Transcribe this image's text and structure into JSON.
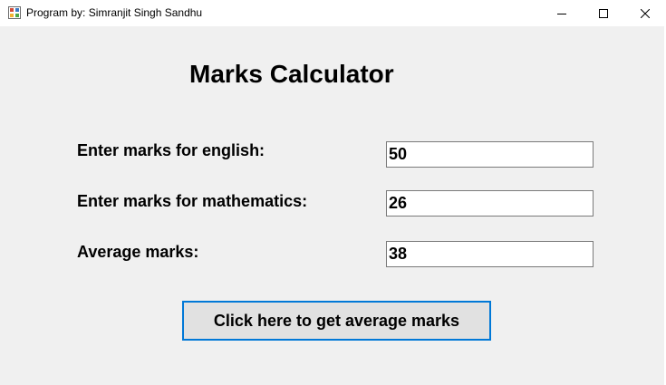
{
  "window": {
    "title": "Program by: Simranjit Singh Sandhu",
    "icon": "windows-form-icon"
  },
  "controls": {
    "minimize_icon": "minimize-icon",
    "maximize_icon": "maximize-icon",
    "close_icon": "close-icon"
  },
  "form": {
    "heading": "Marks Calculator",
    "english_label": "Enter marks for english:",
    "english_value": "50",
    "math_label": "Enter marks for mathematics:",
    "math_value": "26",
    "average_label": "Average marks:",
    "average_value": "38",
    "button_label": "Click here to get average marks"
  },
  "colors": {
    "background": "#f0f0f0",
    "button_border": "#0078d7",
    "button_face": "#e1e1e1",
    "field_border": "#7a7a7a"
  }
}
